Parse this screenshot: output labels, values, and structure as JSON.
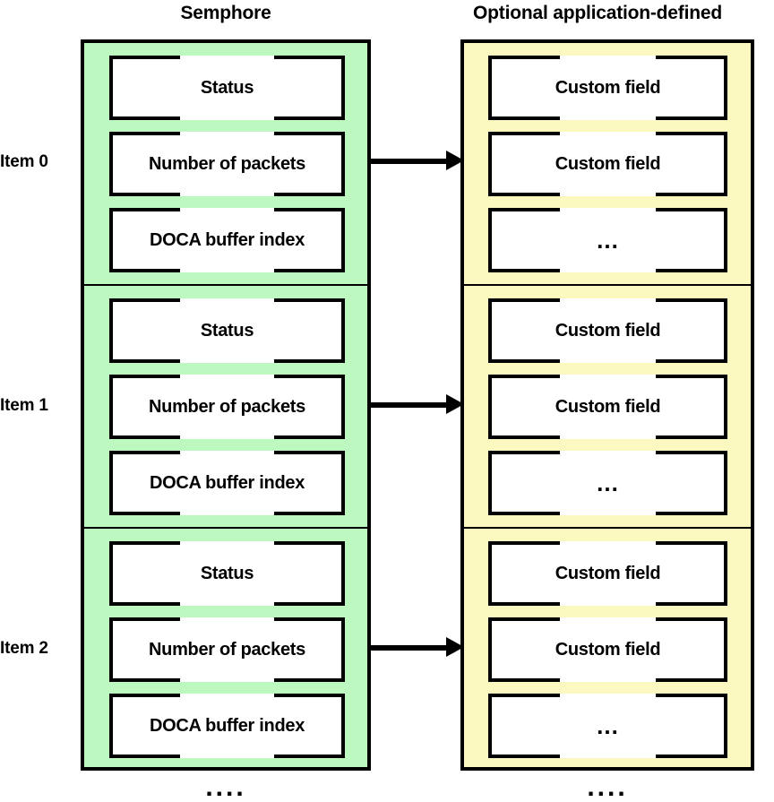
{
  "headers": {
    "semaphore": "Semphore",
    "custom": "Optional application-defined"
  },
  "colors": {
    "semaphore_panel": "#BCF8C0",
    "custom_panel": "#FCF9C0",
    "border": "#000000",
    "field_background": "#FFFFFF",
    "text": "#000000"
  },
  "items": [
    {
      "label": "Item 0",
      "semaphore_fields": [
        "Status",
        "Number of packets",
        "DOCA buffer index"
      ],
      "custom_fields": [
        "Custom field",
        "Custom field",
        "..."
      ],
      "arrow": "arrow-right"
    },
    {
      "label": "Item 1",
      "semaphore_fields": [
        "Status",
        "Number of packets",
        "DOCA buffer index"
      ],
      "custom_fields": [
        "Custom field",
        "Custom field",
        "..."
      ],
      "arrow": "arrow-right"
    },
    {
      "label": "Item 2",
      "semaphore_fields": [
        "Status",
        "Number of packets",
        "DOCA buffer index"
      ],
      "custom_fields": [
        "Custom field",
        "Custom field",
        "..."
      ],
      "arrow": "arrow-right"
    }
  ],
  "continuation": {
    "left": "....",
    "right": "...."
  }
}
